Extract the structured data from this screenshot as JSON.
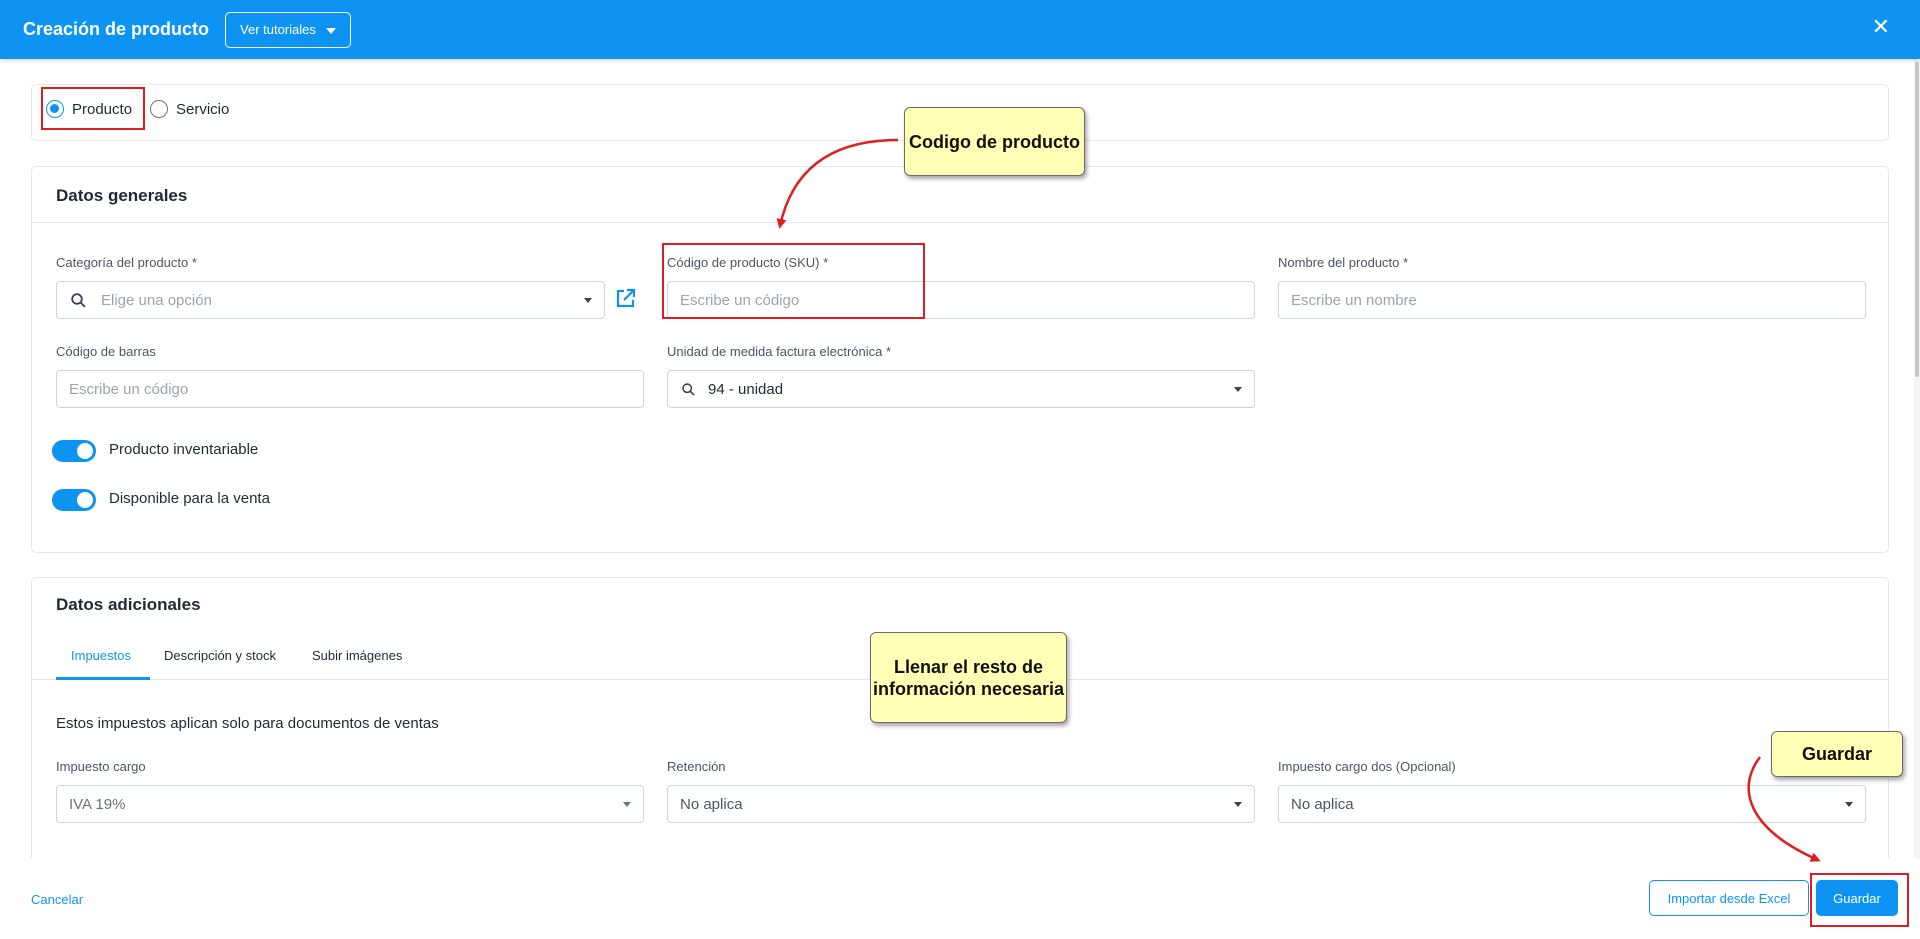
{
  "header": {
    "title": "Creación de producto",
    "tutorials_label": "Ver tutoriales",
    "close_symbol": "✕"
  },
  "item_type": {
    "options": [
      {
        "label": "Producto",
        "selected": true
      },
      {
        "label": "Servicio",
        "selected": false
      }
    ]
  },
  "general": {
    "title": "Datos generales",
    "category": {
      "label": "Categoría del producto *",
      "placeholder": "Elige una opción"
    },
    "sku": {
      "label": "Código de producto (SKU) *",
      "placeholder": "Escribe un código"
    },
    "name": {
      "label": "Nombre del producto *",
      "placeholder": "Escribe un nombre"
    },
    "barcode": {
      "label": "Código de barras",
      "placeholder": "Escribe un código"
    },
    "unit": {
      "label": "Unidad de medida factura electrónica *",
      "value": "94 - unidad"
    },
    "toggles": [
      {
        "label": "Producto inventariable",
        "on": true
      },
      {
        "label": "Disponible para la venta",
        "on": true
      }
    ]
  },
  "additional": {
    "title": "Datos adicionales",
    "tabs": [
      "Impuestos",
      "Descripción y stock",
      "Subir imágenes"
    ],
    "active_tab": "Impuestos",
    "taxes_note": "Estos impuestos aplican solo para documentos de ventas",
    "tax_charge": {
      "label": "Impuesto cargo",
      "value": "IVA 19%"
    },
    "retention": {
      "label": "Retención",
      "value": "No aplica"
    },
    "tax_charge_two": {
      "label": "Impuesto cargo dos (Opcional)",
      "value": "No aplica"
    }
  },
  "footer": {
    "cancel": "Cancelar",
    "import": "Importar desde Excel",
    "save": "Guardar"
  },
  "annotations": {
    "sku_note": "Codigo de producto",
    "fill_note": "Llenar el resto de información necesaria",
    "save_note": "Guardar"
  },
  "colors": {
    "primary": "#0d94f2",
    "highlight": "#e11d1d",
    "note_bg": "#ffffb5"
  }
}
